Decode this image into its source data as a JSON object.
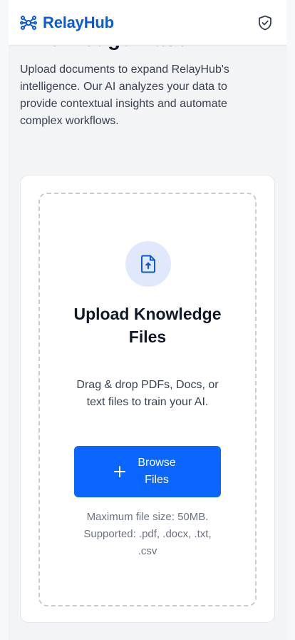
{
  "header": {
    "brand_name": "RelayHub",
    "brand_color": "#0b5bd3",
    "logo_icon": "network-hub-icon",
    "security_icon": "shield-check-icon"
  },
  "main": {
    "title": "Knowledge Base",
    "intro": "Upload documents to expand RelayHub's intelligence. Our AI analyzes your data to provide contextual insights and automate complex workflows."
  },
  "upload_card": {
    "icon": "file-upload-icon",
    "title": "Upload Knowledge Files",
    "description": "Drag & drop PDFs, Docs, or text files to train your AI.",
    "button_label": "Browse Files",
    "button_icon": "plus-icon",
    "button_color": "#0a66ff",
    "note": "Maximum file size: 50MB. Supported: .pdf, .docx, .txt, .csv"
  }
}
